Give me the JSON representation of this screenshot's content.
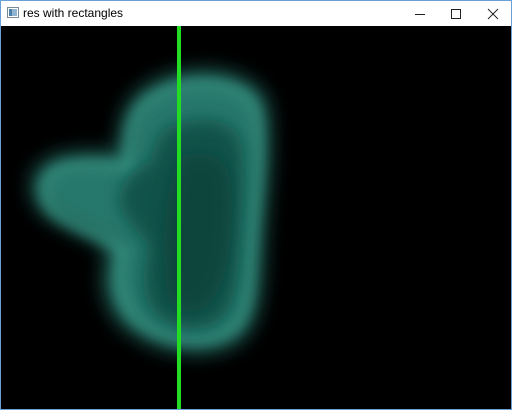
{
  "window": {
    "title": "res with rectangles",
    "icon": "opencv-window-icon",
    "controls": {
      "minimize_icon": "minimize-icon",
      "maximize_icon": "maximize-icon",
      "close_icon": "close-icon"
    }
  },
  "image": {
    "background_color": "#000000",
    "blob_color": "#2e8578",
    "line_color": "#22dd22"
  }
}
